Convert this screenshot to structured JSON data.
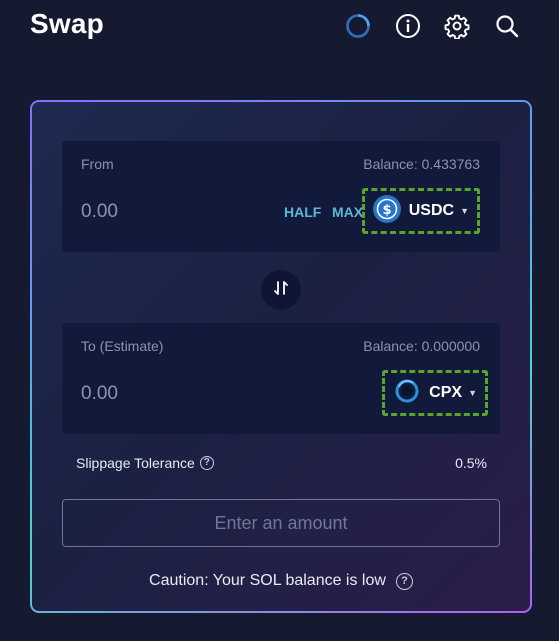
{
  "header": {
    "title": "Swap"
  },
  "from": {
    "label": "From",
    "balance": "Balance: 0.433763",
    "amount": "0.00",
    "half_label": "HALF",
    "max_label": "MAX",
    "token": "USDC"
  },
  "to": {
    "label": "To (Estimate)",
    "balance": "Balance: 0.000000",
    "amount": "0.00",
    "token": "CPX"
  },
  "slippage": {
    "label": "Slippage Tolerance",
    "value": "0.5%"
  },
  "action_button": "Enter an amount",
  "caution": "Caution: Your SOL balance is low",
  "colors": {
    "accent": "#5fb5d9",
    "background": "#151a30",
    "highlight": "#5aa42a"
  },
  "icons": [
    "refresh-ring-icon",
    "info-icon",
    "gear-icon",
    "search-icon",
    "swap-arrows-icon",
    "usdc-icon",
    "cpx-icon",
    "help-icon"
  ]
}
